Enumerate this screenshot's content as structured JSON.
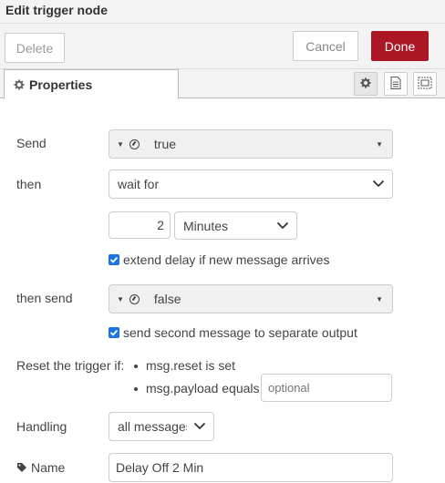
{
  "window": {
    "title": "Edit trigger node"
  },
  "toolbar": {
    "delete_label": "Delete",
    "cancel_label": "Cancel",
    "done_label": "Done"
  },
  "tabs": {
    "properties_label": "Properties"
  },
  "form": {
    "send": {
      "label": "Send",
      "type_icon": "boolean-icon",
      "value": "true"
    },
    "then": {
      "label": "then",
      "value": "wait for"
    },
    "duration": {
      "amount": "2",
      "units": "Minutes"
    },
    "extend": {
      "label": "extend delay if new message arrives",
      "checked": true
    },
    "then_send": {
      "label": "then send",
      "type_icon": "boolean-icon",
      "value": "false"
    },
    "second_output": {
      "label": "send second message to separate output",
      "checked": true
    },
    "reset": {
      "label": "Reset the trigger if:",
      "conditions": [
        "msg.reset is set",
        "msg.payload equals"
      ],
      "placeholder": "optional"
    },
    "handling": {
      "label": "Handling",
      "value": "all messages"
    },
    "name": {
      "label": "Name",
      "value": "Delay Off 2 Min"
    }
  },
  "colors": {
    "accent": "#ad1625",
    "checkbox": "#1a73e8"
  }
}
